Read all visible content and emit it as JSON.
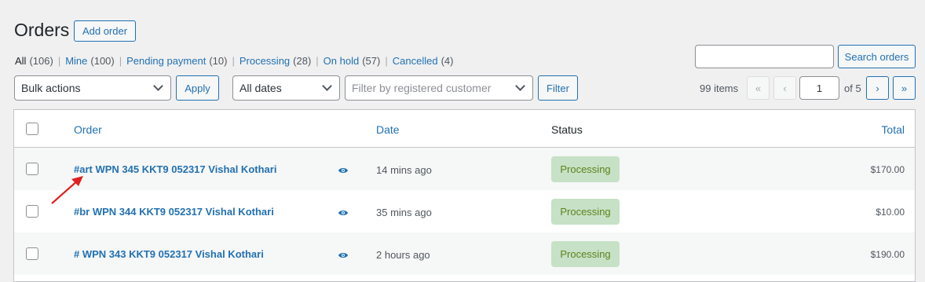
{
  "page": {
    "title": "Orders",
    "add_order_label": "Add order"
  },
  "views": [
    {
      "label": "All",
      "count": "(106)",
      "current": true
    },
    {
      "label": "Mine",
      "count": "(100)",
      "current": false
    },
    {
      "label": "Pending payment",
      "count": "(10)",
      "current": false
    },
    {
      "label": "Processing",
      "count": "(28)",
      "current": false
    },
    {
      "label": "On hold",
      "count": "(57)",
      "current": false
    },
    {
      "label": "Cancelled",
      "count": "(4)",
      "current": false
    }
  ],
  "filters": {
    "bulk_actions": "Bulk actions",
    "apply_label": "Apply",
    "dates": "All dates",
    "customer_placeholder": "Filter by registered customer",
    "filter_label": "Filter"
  },
  "search": {
    "value": "",
    "button_label": "Search orders"
  },
  "pagination": {
    "items": "99 items",
    "first": "«",
    "prev": "‹",
    "current_page": "1",
    "of_pages": "of 5",
    "next": "›",
    "last": "»"
  },
  "table": {
    "headers": {
      "order": "Order",
      "date": "Date",
      "status": "Status",
      "total": "Total"
    },
    "rows": [
      {
        "order": "#art WPN 345 KKT9 052317 Vishal Kothari",
        "date": "14 mins ago",
        "status": "Processing",
        "total": "$170.00"
      },
      {
        "order": "#br WPN 344 KKT9 052317 Vishal Kothari",
        "date": "35 mins ago",
        "status": "Processing",
        "total": "$10.00"
      },
      {
        "order": "# WPN 343 KKT9 052317 Vishal Kothari",
        "date": "2 hours ago",
        "status": "Processing",
        "total": "$190.00"
      }
    ]
  },
  "icons": {
    "preview": "eye-icon",
    "annotation": "red-arrow-icon"
  },
  "colors": {
    "accent": "#2271b1",
    "status_processing_bg": "#c6e1c6",
    "status_processing_text": "#5b841b",
    "annotation": "#e02020"
  }
}
